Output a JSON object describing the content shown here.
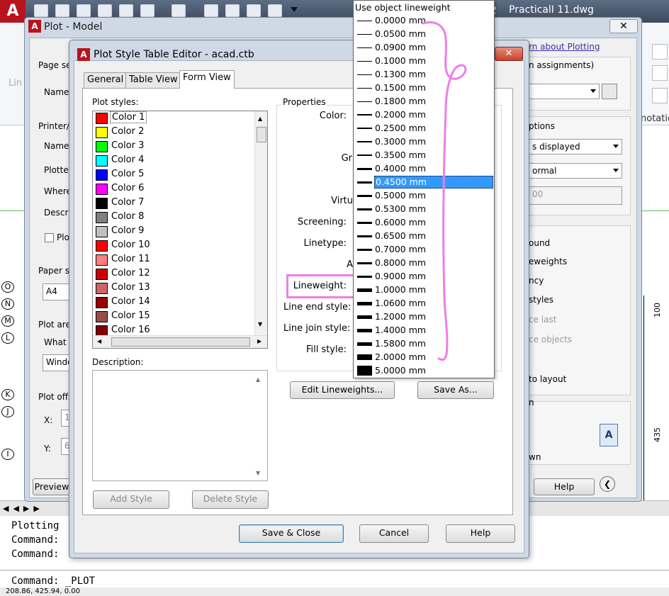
{
  "acad": {
    "logo": "A",
    "title": "PracticalI 11.dwg",
    "drawing_frag": "2",
    "cmd_lines": [
      "Plotting",
      "Command:",
      "Command:"
    ],
    "cmd_current": "Command:  _PLOT",
    "status_coords": "208.86, 425.94, 0.00",
    "ruler": [
      "435",
      "100"
    ],
    "grid_letters": [
      "O",
      "N",
      "M",
      "L",
      "K",
      "J",
      "I"
    ],
    "ribbon_left": "Lin",
    "ribbon_right": "notatio"
  },
  "plot": {
    "title": "Plot - Model",
    "close": "✕",
    "page_setup": "Page se",
    "name": "Name:",
    "printer": "Printer/",
    "printer_name": "Name:",
    "plotter": "Plotter",
    "where": "Where",
    "descr": "Descri",
    "plot_to_file": "Plo",
    "paper": "Paper s",
    "paper_size": "A4",
    "plot_area": "Plot are",
    "what": "What t",
    "window": "Windo",
    "plot_offset": "Plot offs",
    "x": "X:",
    "y": "Y:",
    "x_val": "1",
    "y_val": "6",
    "preview": "Preview",
    "learn": "rn about Plotting",
    "assignments": "n assignments)",
    "options": "ptions",
    "displayed": "s displayed",
    "normal": "ormal",
    "dpi": "00",
    "background": "ound",
    "lineweights": "eweights",
    "transparency": "ncy",
    "styles": "styles",
    "last": "ce last",
    "objects": "ce objects",
    "layout": "to layout",
    "n": "n",
    "down": "wn",
    "help": "Help"
  },
  "pste": {
    "title": "Plot Style Table Editor - acad.ctb",
    "tabs": [
      "General",
      "Table View",
      "Form View"
    ],
    "plot_styles_label": "Plot styles:",
    "styles": [
      {
        "name": "Color 1",
        "color": "#ff0000"
      },
      {
        "name": "Color 2",
        "color": "#ffff00"
      },
      {
        "name": "Color 3",
        "color": "#00ff00"
      },
      {
        "name": "Color 4",
        "color": "#00ffff"
      },
      {
        "name": "Color 5",
        "color": "#0000ff"
      },
      {
        "name": "Color 6",
        "color": "#ff00ff"
      },
      {
        "name": "Color 7",
        "color": "#000000"
      },
      {
        "name": "Color 8",
        "color": "#808080"
      },
      {
        "name": "Color 9",
        "color": "#c0c0c0"
      },
      {
        "name": "Color 10",
        "color": "#ff0000"
      },
      {
        "name": "Color 11",
        "color": "#ff7f7f"
      },
      {
        "name": "Color 12",
        "color": "#cc0000"
      },
      {
        "name": "Color 13",
        "color": "#cc6666"
      },
      {
        "name": "Color 14",
        "color": "#990000"
      },
      {
        "name": "Color 15",
        "color": "#994c4c"
      },
      {
        "name": "Color 16",
        "color": "#7f0000"
      }
    ],
    "description_label": "Description:",
    "properties_label": "Properties",
    "props": {
      "color": "Color:",
      "gray": "Gr",
      "virtual": "Virtu",
      "screening": "Screening:",
      "linetype": "Linetype:",
      "adaptive": "A",
      "lineweight": "Lineweight:",
      "line_end": "Line end style:",
      "line_join": "Line join style:",
      "fill": "Fill style:"
    },
    "add_style": "Add Style",
    "delete_style": "Delete Style",
    "edit_lineweights": "Edit Lineweights...",
    "save_as": "Save As...",
    "save_close": "Save & Close",
    "cancel": "Cancel",
    "help": "Help"
  },
  "lineweights": {
    "header": "Use object lineweight",
    "items": [
      "0.0000 mm",
      "0.0500 mm",
      "0.0900 mm",
      "0.1000 mm",
      "0.1300 mm",
      "0.1500 mm",
      "0.1800 mm",
      "0.2000 mm",
      "0.2500 mm",
      "0.3000 mm",
      "0.3500 mm",
      "0.4000 mm",
      "0.4500 mm",
      "0.5000 mm",
      "0.5300 mm",
      "0.6000 mm",
      "0.6500 mm",
      "0.7000 mm",
      "0.8000 mm",
      "0.9000 mm",
      "1.0000 mm",
      "1.0600 mm",
      "1.2000 mm",
      "1.4000 mm",
      "1.5800 mm",
      "2.0000 mm",
      "5.0000 mm"
    ],
    "values_mm": [
      0.0,
      0.05,
      0.09,
      0.1,
      0.13,
      0.15,
      0.18,
      0.2,
      0.25,
      0.3,
      0.35,
      0.4,
      0.45,
      0.5,
      0.53,
      0.6,
      0.65,
      0.7,
      0.8,
      0.9,
      1.0,
      1.06,
      1.2,
      1.4,
      1.58,
      2.0,
      5.0
    ],
    "selected_index": 12
  },
  "annotation_color": "#f07de8"
}
